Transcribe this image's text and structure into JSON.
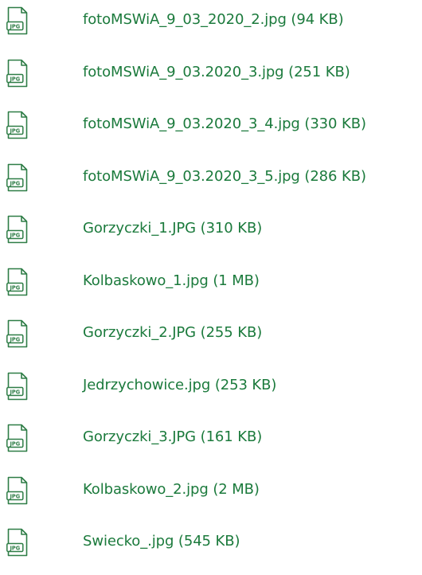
{
  "colors": {
    "accent": "#1b7a3c",
    "icon": "#2e7d46"
  },
  "icon": {
    "name": "jpg-file-icon",
    "label": "JPG"
  },
  "files": [
    {
      "name": "fotoMSWiA_9_03_2020_2.jpg",
      "size": "(94 KB)"
    },
    {
      "name": "fotoMSWiA_9_03.2020_3.jpg",
      "size": "(251 KB)"
    },
    {
      "name": "fotoMSWiA_9_03.2020_3_4.jpg",
      "size": "(330 KB)"
    },
    {
      "name": "fotoMSWiA_9_03.2020_3_5.jpg",
      "size": "(286 KB)"
    },
    {
      "name": "Gorzyczki_1.JPG",
      "size": "(310 KB)"
    },
    {
      "name": "Kolbaskowo_1.jpg",
      "size": "(1 MB)"
    },
    {
      "name": "Gorzyczki_2.JPG",
      "size": "(255 KB)"
    },
    {
      "name": "Jedrzychowice.jpg",
      "size": "(253 KB)"
    },
    {
      "name": "Gorzyczki_3.JPG",
      "size": "(161 KB)"
    },
    {
      "name": "Kolbaskowo_2.jpg",
      "size": "(2 MB)"
    },
    {
      "name": "Swiecko_.jpg",
      "size": "(545 KB)"
    }
  ]
}
